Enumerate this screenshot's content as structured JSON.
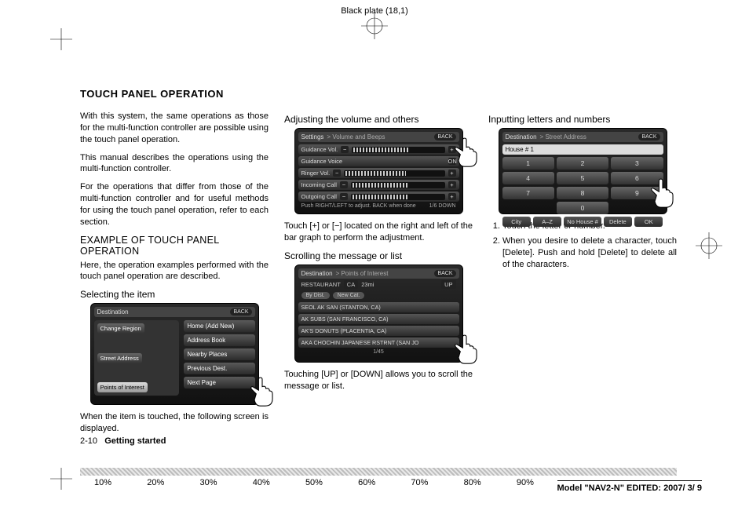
{
  "top_note": "Black plate (18,1)",
  "section_title": "TOUCH PANEL OPERATION",
  "col1": {
    "p1": "With this system, the same operations as those for the multi-function controller are possible using the touch panel operation.",
    "p2": "This manual describes the operations using the multi-function controller.",
    "p3": "For the operations that differ from those of the multi-function controller and for useful methods for using the touch panel operation, refer to each section.",
    "h_example": "EXAMPLE OF TOUCH PANEL OPERATION",
    "p4": "Here, the operation examples performed with the touch panel operation are described.",
    "h_select": "Selecting the item",
    "p5": "When the item is touched, the following screen is displayed."
  },
  "col2": {
    "h_adjust": "Adjusting the volume and others",
    "p_adjust": "Touch [+] or [−] located on the right and left of the bar graph to perform the adjustment.",
    "h_scroll": "Scrolling the message or list",
    "p_scroll": "Touching [UP] or [DOWN] allows you to scroll the message or list."
  },
  "col3": {
    "h_input": "Inputting letters and numbers",
    "li1": "Touch the letter or number.",
    "li2": "When you desire to delete a character, touch [Delete]. Push and hold [Delete] to delete all of the characters."
  },
  "shot1": {
    "title": "Destination",
    "back": "BACK",
    "left": {
      "change_region": "Change Region",
      "street_address": "Street Address",
      "poi": "Points of Interest"
    },
    "right": [
      "Home (Add New)",
      "Address Book",
      "Nearby Places",
      "Previous Dest.",
      "Next Page"
    ]
  },
  "shot2": {
    "title": "Settings",
    "crumb": "Volume and Beeps",
    "back": "BACK",
    "rows": [
      {
        "label": "Guidance Vol."
      },
      {
        "label": "Guidance Voice",
        "state": "ON"
      },
      {
        "label": "Ringer Vol."
      },
      {
        "label": "Incoming Call"
      },
      {
        "label": "Outgoing Call"
      }
    ],
    "foot_left": "Push RIGHT/LEFT to adjust. BACK when done",
    "foot_right": "1/6   DOWN"
  },
  "shot3": {
    "title": "Destination",
    "crumb": "Points of Interest",
    "back": "BACK",
    "info": {
      "name": "RESTAURANT",
      "state": "CA",
      "dist": "23mi",
      "up": "UP"
    },
    "pills": [
      "By Dist.",
      "New Cat."
    ],
    "list": [
      "SEOL AK SAN (STANTON, CA)",
      "AK SUBS (SAN FRANCISCO, CA)",
      "AK'S DONUTS (PLACENTIA, CA)",
      "AKA CHOCHIN JAPANESE RSTRNT (SAN JO"
    ],
    "pager": "1/45"
  },
  "shot4": {
    "title": "Destination",
    "crumb": "Street Address",
    "back": "BACK",
    "field_label": "House #",
    "field_value": "1",
    "keys": [
      "1",
      "2",
      "3",
      "4",
      "5",
      "6",
      "7",
      "8",
      "9",
      "0"
    ],
    "bottom": [
      "City",
      "A–Z",
      "No House #",
      "Delete",
      "OK"
    ]
  },
  "footer": {
    "page": "2-10",
    "chapter": "Getting started"
  },
  "ruler": [
    "10%",
    "20%",
    "30%",
    "40%",
    "50%",
    "60%",
    "70%",
    "80%",
    "90%"
  ],
  "model_line": {
    "prefix": "Model ",
    "model": "\"NAV2-N\"",
    "mid": " EDITED: ",
    "date": "2007/ 3/ 9"
  }
}
